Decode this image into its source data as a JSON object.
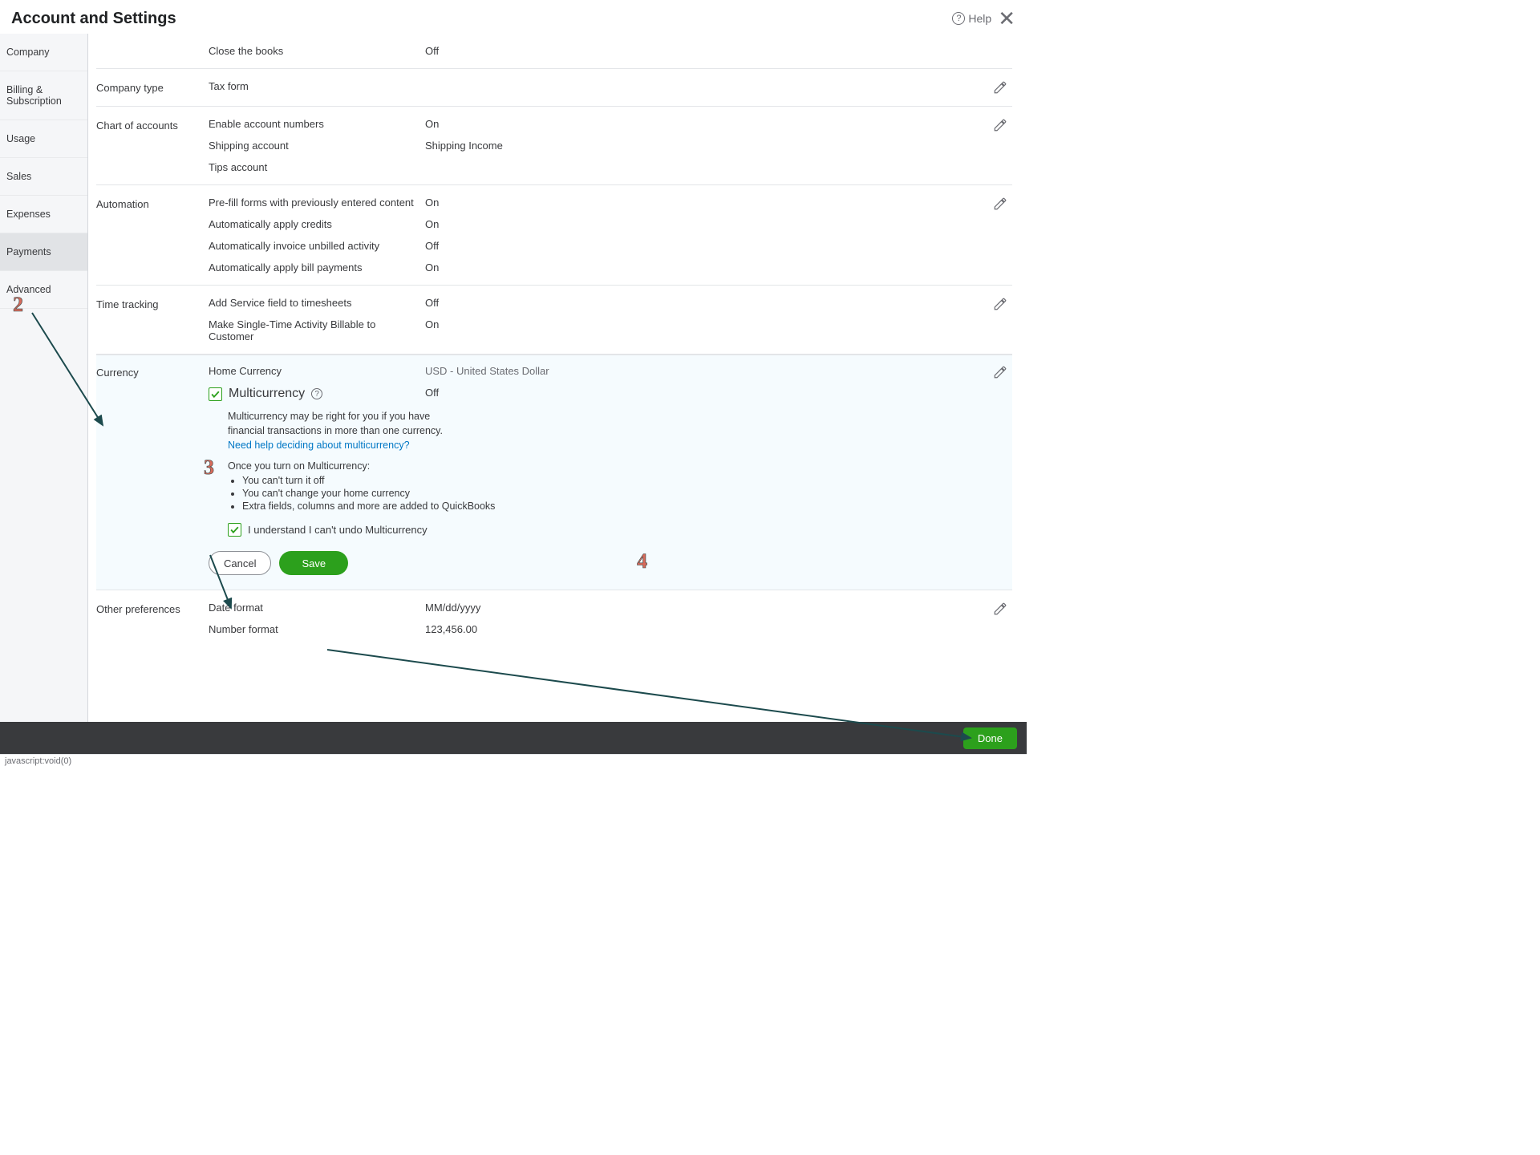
{
  "header": {
    "title": "Account and Settings",
    "help": "Help"
  },
  "sidebar": {
    "items": [
      {
        "label": "Company"
      },
      {
        "label": "Billing & Subscription"
      },
      {
        "label": "Usage"
      },
      {
        "label": "Sales"
      },
      {
        "label": "Expenses"
      },
      {
        "label": "Payments"
      },
      {
        "label": "Advanced"
      }
    ]
  },
  "sections": {
    "closeBooks": {
      "label": "Close the books",
      "value": "Off"
    },
    "companyType": {
      "title": "Company type",
      "label": "Tax form"
    },
    "chartOfAccounts": {
      "title": "Chart of accounts",
      "rows": [
        {
          "label": "Enable account numbers",
          "value": "On"
        },
        {
          "label": "Shipping account",
          "value": "Shipping Income"
        },
        {
          "label": "Tips account",
          "value": ""
        }
      ]
    },
    "automation": {
      "title": "Automation",
      "rows": [
        {
          "label": "Pre-fill forms with previously entered content",
          "value": "On"
        },
        {
          "label": "Automatically apply credits",
          "value": "On"
        },
        {
          "label": "Automatically invoice unbilled activity",
          "value": "Off"
        },
        {
          "label": "Automatically apply bill payments",
          "value": "On"
        }
      ]
    },
    "timeTracking": {
      "title": "Time tracking",
      "rows": [
        {
          "label": "Add Service field to timesheets",
          "value": "Off"
        },
        {
          "label": "Make Single-Time Activity Billable to Customer",
          "value": "On"
        }
      ]
    },
    "currency": {
      "title": "Currency",
      "homeLabel": "Home Currency",
      "homeValue": "USD - United States Dollar",
      "mcLabel": "Multicurrency",
      "mcValue": "Off",
      "desc": "Multicurrency may be right for you if you have financial transactions in more than one currency.",
      "helpLink": "Need help deciding about multicurrency?",
      "onceTitle": "Once you turn on Multicurrency:",
      "onceItems": [
        "You can't turn it off",
        "You can't change your home currency",
        "Extra fields, columns and more are added to QuickBooks"
      ],
      "confirmLabel": "I understand I can't undo Multicurrency",
      "cancel": "Cancel",
      "save": "Save"
    },
    "otherPrefs": {
      "title": "Other preferences",
      "rows": [
        {
          "label": "Date format",
          "value": "MM/dd/yyyy"
        },
        {
          "label": "Number format",
          "value": "123,456.00"
        }
      ]
    }
  },
  "footer": {
    "done": "Done"
  },
  "status": "javascript:void(0)",
  "annotations": {
    "n2": "2",
    "n3": "3",
    "n4": "4"
  }
}
